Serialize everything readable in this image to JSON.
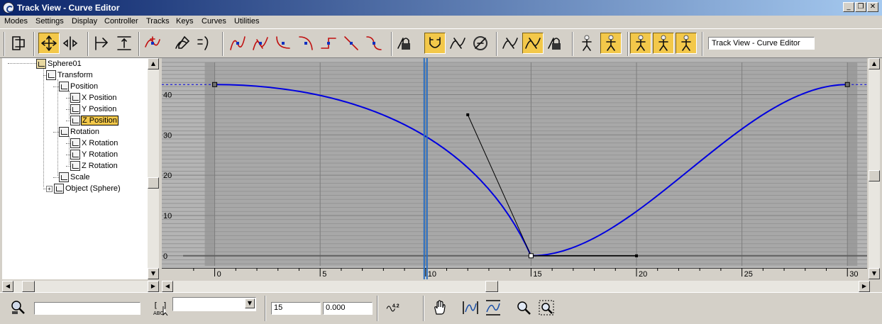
{
  "window": {
    "title": "Track View - Curve Editor",
    "minimize_glyph": "_",
    "restore_glyph": "❐",
    "close_glyph": "✕"
  },
  "menu": [
    "Modes",
    "Settings",
    "Display",
    "Controller",
    "Tracks",
    "Keys",
    "Curves",
    "Utilities"
  ],
  "toolbar": {
    "view_name": "Track View - Curve Editor",
    "buttons": [
      {
        "name": "filters-icon"
      },
      {
        "name": "move-keys-icon",
        "active": true
      },
      {
        "name": "slide-keys-icon"
      },
      {
        "name": "scale-keys-icon"
      },
      {
        "name": "scale-values-icon"
      },
      {
        "name": "add-keys-icon"
      },
      {
        "name": "draw-curves-icon"
      },
      {
        "name": "reduce-keys-icon"
      },
      {
        "name": "tangent-auto-icon"
      },
      {
        "name": "tangent-custom-icon"
      },
      {
        "name": "tangent-fast-icon"
      },
      {
        "name": "tangent-slow-icon"
      },
      {
        "name": "tangent-step-icon"
      },
      {
        "name": "tangent-linear-icon"
      },
      {
        "name": "tangent-smooth-icon"
      },
      {
        "name": "lock-selection-icon"
      },
      {
        "name": "snap-frames-icon",
        "active": true
      },
      {
        "name": "parameter-curve-out-of-range-icon"
      },
      {
        "name": "show-keyable-icon"
      },
      {
        "name": "show-all-tangents-icon"
      },
      {
        "name": "show-tangents-icon",
        "active": true
      },
      {
        "name": "lock-tangents-icon"
      },
      {
        "name": "biped-display-icon"
      },
      {
        "name": "biped-position-icon",
        "active": true
      },
      {
        "name": "biped-rotation-icon",
        "active": true
      },
      {
        "name": "biped-scale-icon",
        "active": true
      },
      {
        "name": "biped-curves-icon",
        "active": true
      }
    ]
  },
  "tree": {
    "items": [
      {
        "label": "Sphere01",
        "icon": "sphere-object-icon",
        "indent": 0
      },
      {
        "label": "Transform",
        "icon": "transform-icon",
        "indent": 1
      },
      {
        "label": "Position",
        "icon": "position-icon",
        "indent": 2
      },
      {
        "label": "X Position",
        "icon": "curve-track-icon",
        "indent": 3
      },
      {
        "label": "Y Position",
        "icon": "curve-track-icon",
        "indent": 3
      },
      {
        "label": "Z Position",
        "icon": "curve-track-icon",
        "indent": 3,
        "selected": true
      },
      {
        "label": "Rotation",
        "icon": "rotation-icon",
        "indent": 2
      },
      {
        "label": "X Rotation",
        "icon": "curve-track-icon",
        "indent": 3
      },
      {
        "label": "Y Rotation",
        "icon": "curve-track-icon",
        "indent": 3
      },
      {
        "label": "Z Rotation",
        "icon": "curve-track-icon",
        "indent": 3
      },
      {
        "label": "Scale",
        "icon": "scale-icon",
        "indent": 2
      },
      {
        "label": "Object (Sphere)",
        "icon": "object-modifier-icon",
        "indent": 1,
        "expandable": true
      }
    ]
  },
  "graph": {
    "y_ticks": [
      0,
      10,
      20,
      30,
      40
    ],
    "x_ticks": [
      0,
      5,
      10,
      15,
      20,
      25,
      30
    ],
    "x_range": [
      -1.5,
      30.8
    ],
    "y_range": [
      -2.5,
      48.0
    ],
    "frame_range": [
      0,
      30
    ],
    "current_frame": 10,
    "keys": [
      {
        "frame": 0,
        "value": 42.5
      },
      {
        "frame": 15,
        "value": 0
      },
      {
        "frame": 30,
        "value": 42.5
      }
    ],
    "selected_key": {
      "frame": 15,
      "value": 0,
      "in_handle": {
        "frame": 12,
        "value": 35
      },
      "out_handle": {
        "frame": 20,
        "value": 0
      }
    },
    "curve_color": "#0000e0",
    "time_slider_color": "#2a6fc2"
  },
  "status": {
    "frame_value": "15",
    "key_value": "0.000",
    "readout_text": "4.2"
  }
}
